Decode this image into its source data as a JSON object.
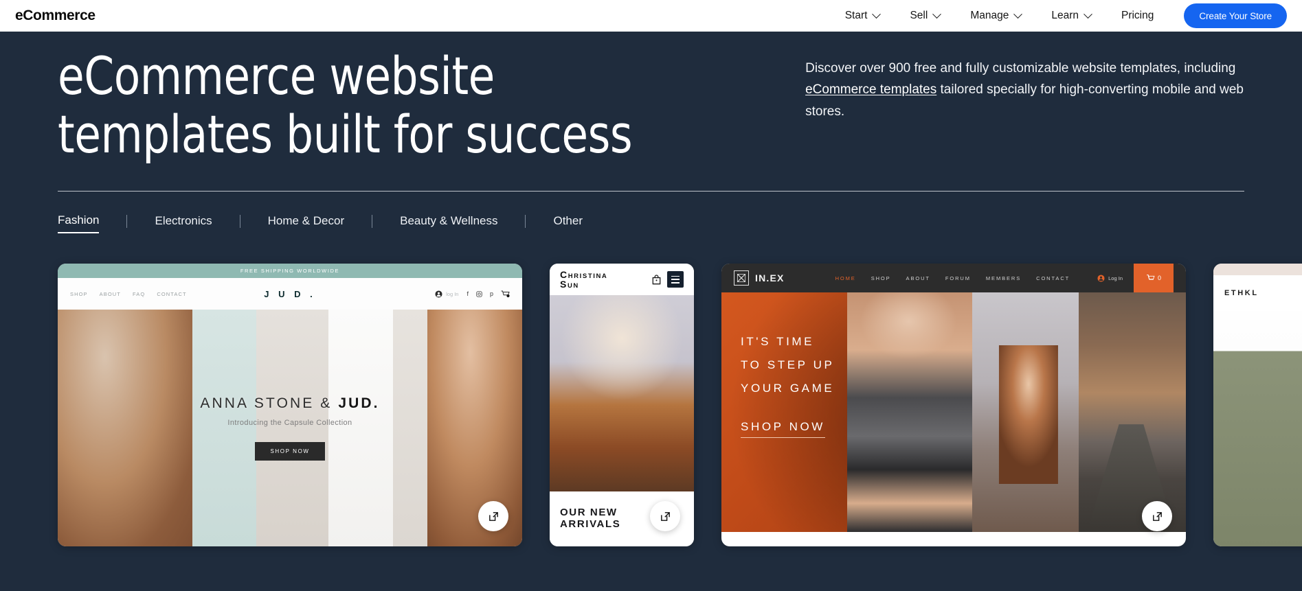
{
  "topnav": {
    "brand": "eCommerce",
    "items": [
      {
        "label": "Start",
        "has_chevron": true
      },
      {
        "label": "Sell",
        "has_chevron": true
      },
      {
        "label": "Manage",
        "has_chevron": true
      },
      {
        "label": "Learn",
        "has_chevron": true
      },
      {
        "label": "Pricing",
        "has_chevron": false
      }
    ],
    "cta_label": "Create Your Store",
    "cta_color": "#1565f0"
  },
  "hero": {
    "headline_line1": "eCommerce website",
    "headline_line2": "templates built for success",
    "desc_part1": "Discover over 900 free and fully customizable website templates, including ",
    "desc_link": "eCommerce templates",
    "desc_part2": " tailored specially for high-converting mobile and web stores."
  },
  "tabs": {
    "items": [
      {
        "label": "Fashion",
        "active": true
      },
      {
        "label": "Electronics",
        "active": false
      },
      {
        "label": "Home & Decor",
        "active": false
      },
      {
        "label": "Beauty & Wellness",
        "active": false
      },
      {
        "label": "Other",
        "active": false
      }
    ]
  },
  "cards": {
    "card1": {
      "banner": "FREE SHIPPING WORLDWIDE",
      "nav": [
        "SHOP",
        "ABOUT",
        "FAQ",
        "CONTACT"
      ],
      "brand": "J U D .",
      "login": "log In",
      "cart_count": "0",
      "hero_title_plain": "ANNA STONE & ",
      "hero_title_bold": "JUD.",
      "hero_sub": "Introducing the Capsule Collection",
      "hero_cta": "SHOP NOW",
      "open_label": "open-template"
    },
    "card2": {
      "brand_line1": "CHRISTINA",
      "brand_line2": "SUN",
      "foot_line1": "OUR NEW",
      "foot_line2": "ARRIVALS",
      "open_label": "open-template"
    },
    "card3": {
      "brand": "IN.EX",
      "nav": [
        "HOME",
        "SHOP",
        "ABOUT",
        "FORUM",
        "MEMBERS",
        "CONTACT"
      ],
      "active_nav": "HOME",
      "accent_color": "#e2622a",
      "login": "Log In",
      "cart_count": "0",
      "hero_line1": "IT'S TIME",
      "hero_line2": "TO STEP UP",
      "hero_line3": "YOUR GAME",
      "hero_cta": "SHOP NOW",
      "open_label": "open-template"
    },
    "card4": {
      "brand": "ETHKL"
    }
  }
}
